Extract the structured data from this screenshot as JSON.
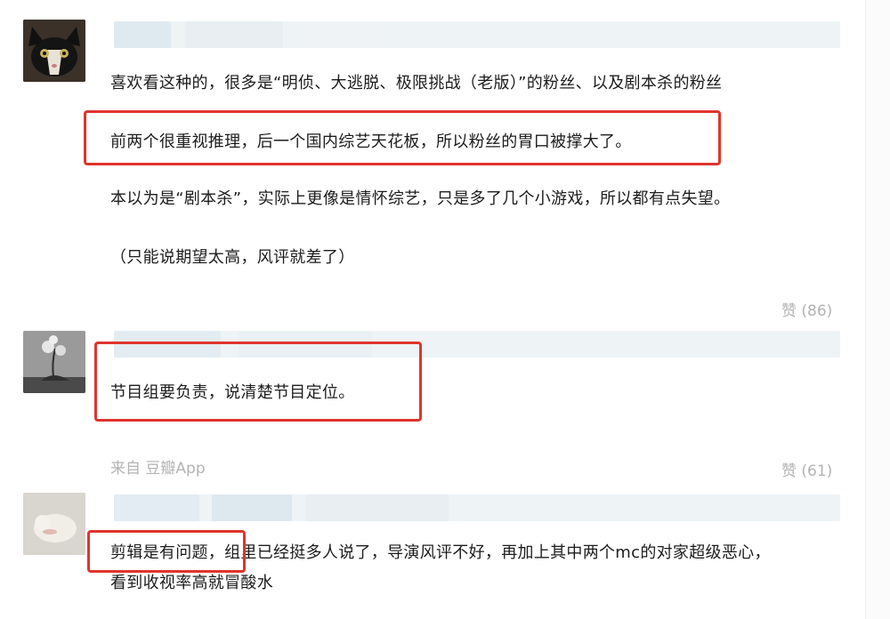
{
  "comments": [
    {
      "lines": [
        "喜欢看这种的，很多是“明侦、大逃脱、极限挑战（老版）”的粉丝、以及剧本杀的粉丝",
        "前两个很重视推理，后一个国内综艺天花板，所以粉丝的胃口被撑大了。",
        "本以为是“剧本杀”，实际上更像是情怀综艺，只是多了几个小游戏，所以都有点失望。",
        "（只能说期望太高，风评就差了）"
      ],
      "likes": "赞 (86)"
    },
    {
      "lines": [
        "节目组要负责，说清楚节目定位。"
      ],
      "source": "来自 豆瓣App",
      "likes": "赞 (61)"
    },
    {
      "lines": [
        "剪辑是有问题，组里已经挺多人说了，导演风评不好，再加上其中两个mc的对家超级恶心，",
        "看到收视率高就冒酸水"
      ]
    }
  ],
  "colors": {
    "highlight": "#e0342e",
    "meta": "#b3b3b3",
    "blur": "#e3ecf2"
  }
}
